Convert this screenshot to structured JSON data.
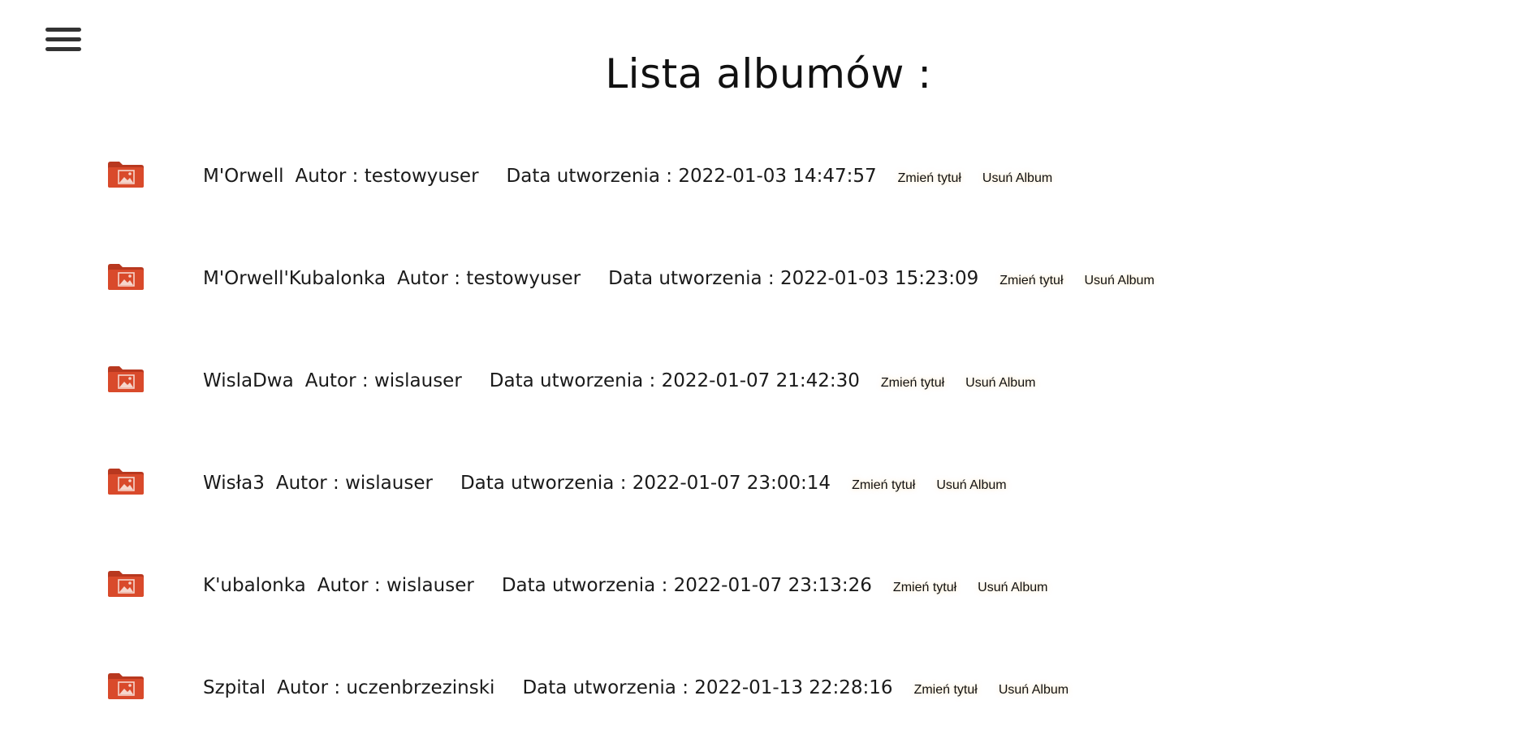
{
  "header": {
    "menu_icon": "hamburger-menu-icon",
    "title": "Lista albumów :"
  },
  "labels": {
    "author_prefix": "Autor : ",
    "date_prefix": "Data utworzenia : ",
    "rename_button": "Zmień tytuł",
    "delete_button": "Usuń Album"
  },
  "colors": {
    "folder_icon": "#d94a2b",
    "button_glow": "#ffc878"
  },
  "albums": [
    {
      "name": "M'Orwell",
      "author": "testowyuser",
      "created": "2022-01-03 14:47:57"
    },
    {
      "name": "M'Orwell'Kubalonka",
      "author": "testowyuser",
      "created": "2022-01-03 15:23:09"
    },
    {
      "name": "WislaDwa",
      "author": "wislauser",
      "created": "2022-01-07 21:42:30"
    },
    {
      "name": "Wisła3",
      "author": "wislauser",
      "created": "2022-01-07 23:00:14"
    },
    {
      "name": "K'ubalonka",
      "author": "wislauser",
      "created": "2022-01-07 23:13:26"
    },
    {
      "name": "Szpital",
      "author": "uczenbrzezinski",
      "created": "2022-01-13 22:28:16"
    }
  ]
}
